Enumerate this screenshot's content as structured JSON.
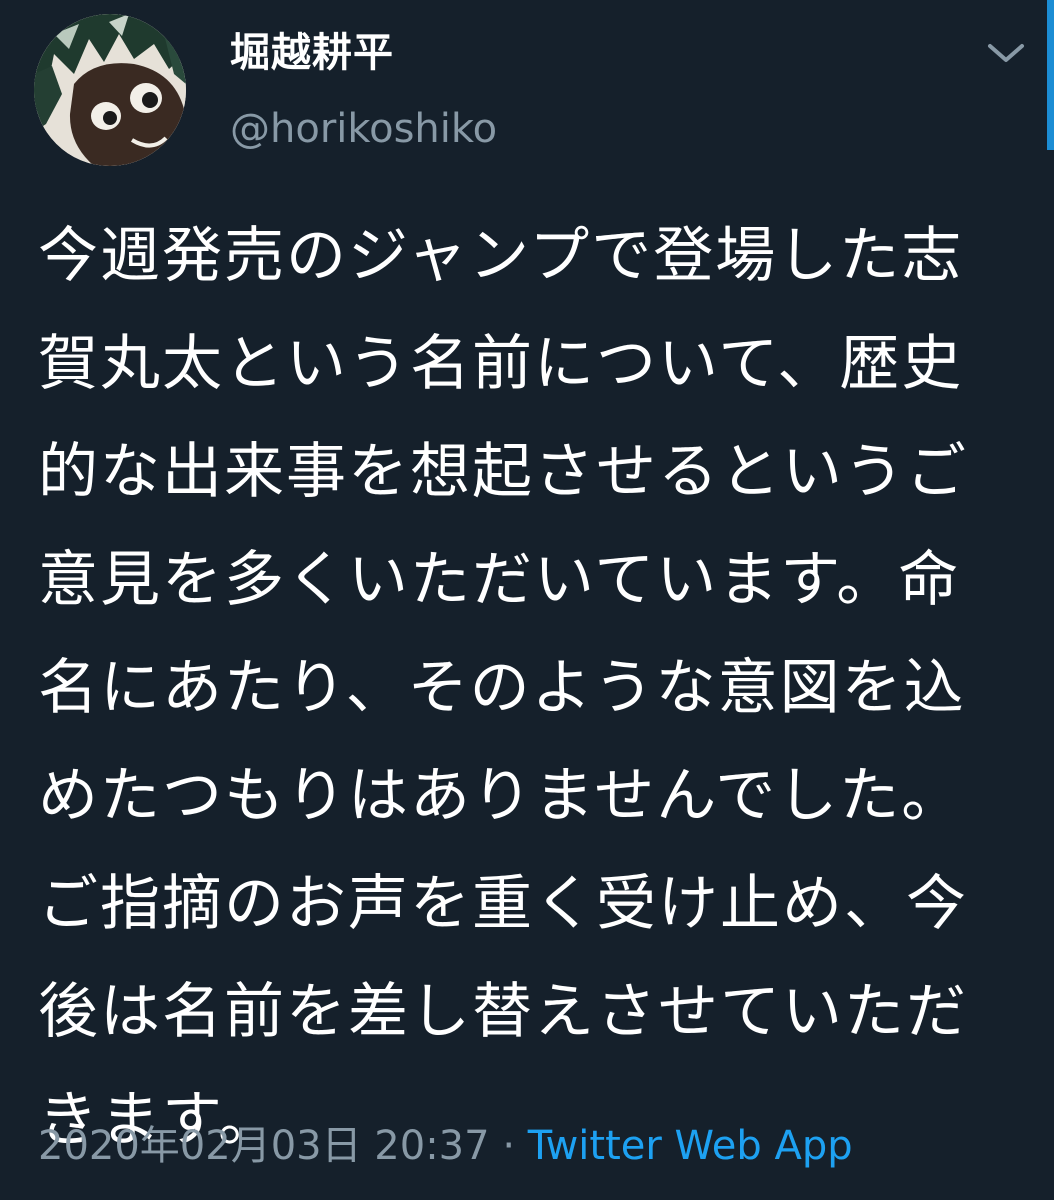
{
  "tweet": {
    "author": {
      "display_name": "堀越耕平",
      "handle": "@horikoshiko",
      "avatar": "avatar-character-portrait"
    },
    "menu_icon": "chevron-down-icon",
    "text": "今週発売のジャンプで登場した志\n賀丸太という名前について、歴史\n的な出来事を想起させるというご\n意見を多くいただいています。命\n名にあたり、そのような意図を込\nめたつもりはありませんでした。\nご指摘のお声を重く受け止め、今\n後は名前を差し替えさせていただ\nきます。",
    "timestamp": "2020年02月03日 20:37",
    "separator": "·",
    "source": "Twitter Web App"
  },
  "colors": {
    "background": "#15202b",
    "text_primary": "#ffffff",
    "text_secondary": "#8899a6",
    "accent": "#1da1f2"
  }
}
